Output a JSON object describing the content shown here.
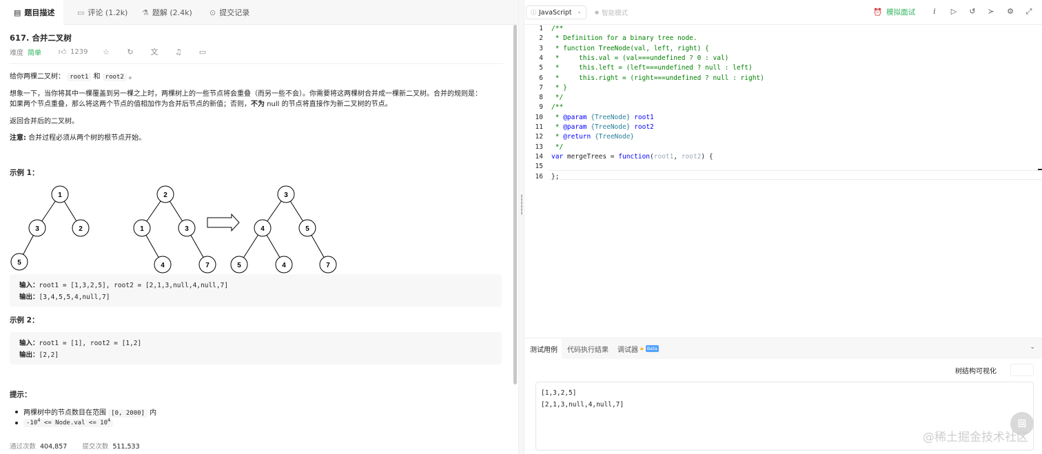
{
  "tabs": [
    {
      "label": "题目描述",
      "icon": "description-icon"
    },
    {
      "label": "评论 (1.2k)",
      "icon": "comment-icon"
    },
    {
      "label": "题解 (2.4k)",
      "icon": "solution-icon"
    },
    {
      "label": "提交记录",
      "icon": "history-icon"
    }
  ],
  "problem": {
    "title": "617. 合并二叉树",
    "difficulty_label": "难度",
    "difficulty": "简单",
    "likes": "1239",
    "description": {
      "p1_before": "给你两棵二叉树：",
      "p1_code1": "root1",
      "p1_mid": "和",
      "p1_code2": "root2",
      "p1_after": "。",
      "p2": "想象一下，当你将其中一棵覆盖到另一棵之上时，两棵树上的一些节点将会重叠（而另一些不会）。你需要将这两棵树合并成一棵新二叉树。合并的规则是：",
      "p3_before": "如果两个节点重叠，那么将这两个节点的值相加作为合并后节点的新值；否则，",
      "p3_bold": "不为",
      "p3_after": "null 的节点将直接作为新二叉树的节点。",
      "p4": "返回合并后的二叉树。",
      "note_label": "注意:",
      "note": "合并过程必须从两个树的根节点开始。"
    },
    "examples": [
      {
        "title": "示例 1：",
        "input_label": "输入：",
        "input": "root1 = [1,3,2,5], root2 = [2,1,3,null,4,null,7]",
        "output_label": "输出：",
        "output": "[3,4,5,5,4,null,7]"
      },
      {
        "title": "示例 2：",
        "input_label": "输入：",
        "input": "root1 = [1], root2 = [1,2]",
        "output_label": "输出：",
        "output": "[2,2]"
      }
    ],
    "trees": {
      "tree1": [
        "1",
        "3",
        "2",
        "5"
      ],
      "tree2": [
        "2",
        "1",
        "3",
        "4",
        "7"
      ],
      "merged": [
        "3",
        "4",
        "5",
        "5",
        "4",
        "7"
      ]
    },
    "hints_title": "提示：",
    "hint1_text": "两棵树中的节点数目在范围",
    "hint1_code": "[0, 2000]",
    "hint1_after": "内",
    "hint2_pre": "-10",
    "hint2_sup1": "4",
    "hint2_mid": " <= Node.val <= 10",
    "hint2_sup2": "4",
    "stats": {
      "accepted_label": "通过次数",
      "accepted": "404,857",
      "submissions_label": "提交次数",
      "submissions": "511,533"
    }
  },
  "toolbar": {
    "language": "JavaScript",
    "smart_mode": "智能模式",
    "mock_interview": "模拟面试"
  },
  "code": {
    "line_numbers": [
      "1",
      "2",
      "3",
      "4",
      "5",
      "6",
      "7",
      "8",
      "9",
      "10",
      "11",
      "12",
      "13",
      "14",
      "15",
      "16"
    ]
  },
  "bottom": {
    "tabs": [
      "测试用例",
      "代码执行结果",
      "调试器"
    ],
    "beta": "Beta",
    "viz_label": "树结构可视化",
    "test_lines": [
      "[1,3,2,5]",
      "[2,1,3,null,4,null,7]"
    ]
  },
  "watermark": "@稀土掘金技术社区",
  "back_top": "回"
}
